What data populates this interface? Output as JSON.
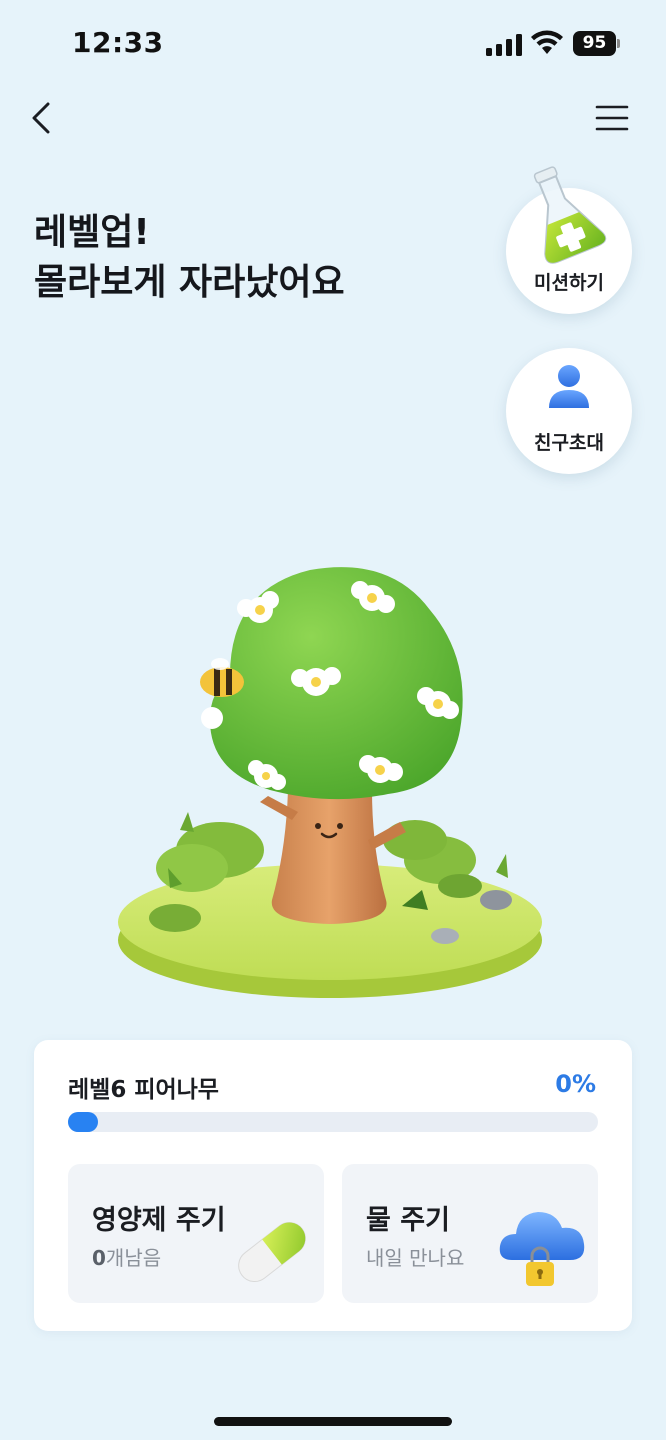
{
  "status_bar": {
    "time": "12:33",
    "battery": "95"
  },
  "header": {
    "headline_line1": "레벨업!",
    "headline_line2": "몰라보게 자라났어요"
  },
  "side_actions": {
    "mission_label": "미션하기",
    "invite_label": "친구초대"
  },
  "progress": {
    "level_label": "레벨6 피어나무",
    "percent_text": "0%",
    "percent": 0
  },
  "actions": {
    "nutrient": {
      "title": "영양제 주기",
      "count": "0",
      "suffix": "개남음"
    },
    "water": {
      "title": "물 주기",
      "subtitle": "내일 만나요"
    }
  },
  "icons": {
    "back": "chevron-left-icon",
    "menu": "hamburger-menu-icon",
    "mission": "flask-icon",
    "invite": "person-icon",
    "nutrient": "pill-capsule-icon",
    "water": "cloud-lock-icon"
  },
  "colors": {
    "accent": "#2d7be5",
    "background": "#e6f3fa",
    "progress": "#2882f2"
  }
}
